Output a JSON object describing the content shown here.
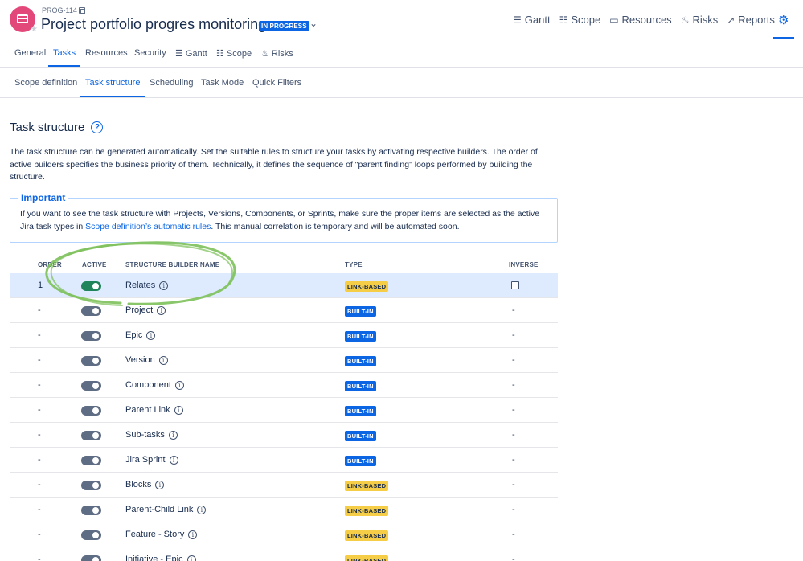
{
  "header": {
    "project_key": "PROG-114",
    "title": "Project portfolio progres monitoring",
    "status": "IN PROGRESS",
    "nav": [
      {
        "label": "Gantt",
        "icon": "gantt-icon",
        "glyph": "☰"
      },
      {
        "label": "Scope",
        "icon": "scope-icon",
        "glyph": "☷"
      },
      {
        "label": "Resources",
        "icon": "resources-icon",
        "glyph": "▭"
      },
      {
        "label": "Risks",
        "icon": "risks-icon",
        "glyph": "🔥"
      },
      {
        "label": "Reports",
        "icon": "reports-icon",
        "glyph": "📈"
      }
    ],
    "settings_icon": "gear-icon"
  },
  "tabs_primary": [
    {
      "label": "General",
      "icon": ""
    },
    {
      "label": "Tasks",
      "icon": "",
      "active": true
    },
    {
      "label": "Resources",
      "icon": ""
    },
    {
      "label": "Security",
      "icon": ""
    },
    {
      "label": "Gantt",
      "icon": "gantt-icon"
    },
    {
      "label": "Scope",
      "icon": "scope-icon"
    },
    {
      "label": "Risks",
      "icon": "risks-icon"
    }
  ],
  "tabs_secondary": [
    {
      "label": "Scope definition"
    },
    {
      "label": "Task structure",
      "active": true
    },
    {
      "label": "Scheduling"
    },
    {
      "label": "Task Mode"
    },
    {
      "label": "Quick Filters"
    }
  ],
  "section": {
    "title": "Task structure",
    "description": "The task structure can be generated automatically. Set the suitable rules to structure your tasks by activating respective builders. The order of active builders specifies the business priority of them. Technically, it defines the sequence of \"parent finding\" loops performed by building the structure."
  },
  "important": {
    "label": "Important",
    "text_before": "If you want to see the task structure with Projects, Versions, Components, or Sprints, make sure the proper items are selected as the active Jira task types in ",
    "link": "Scope definition’s automatic rules",
    "text_after": ". This manual correlation is temporary and will be automated soon."
  },
  "table": {
    "headers": {
      "order": "ORDER",
      "active": "ACTIVE",
      "name": "STRUCTURE BUILDER NAME",
      "type": "TYPE",
      "inverse": "INVERSE"
    },
    "rows": [
      {
        "order": "1",
        "active": true,
        "name": "Relates",
        "type": "LINK-BASED",
        "kind": "link",
        "inverse": "checkbox",
        "selected": true
      },
      {
        "order": "-",
        "active": false,
        "name": "Project",
        "type": "BUILT-IN",
        "kind": "builtin",
        "inverse": "-"
      },
      {
        "order": "-",
        "active": false,
        "name": "Epic",
        "type": "BUILT-IN",
        "kind": "builtin",
        "inverse": "-"
      },
      {
        "order": "-",
        "active": false,
        "name": "Version",
        "type": "BUILT-IN",
        "kind": "builtin",
        "inverse": "-"
      },
      {
        "order": "-",
        "active": false,
        "name": "Component",
        "type": "BUILT-IN",
        "kind": "builtin",
        "inverse": "-"
      },
      {
        "order": "-",
        "active": false,
        "name": "Parent Link",
        "type": "BUILT-IN",
        "kind": "builtin",
        "inverse": "-"
      },
      {
        "order": "-",
        "active": false,
        "name": "Sub-tasks",
        "type": "BUILT-IN",
        "kind": "builtin",
        "inverse": "-"
      },
      {
        "order": "-",
        "active": false,
        "name": "Jira Sprint",
        "type": "BUILT-IN",
        "kind": "builtin",
        "inverse": "-"
      },
      {
        "order": "-",
        "active": false,
        "name": "Blocks",
        "type": "LINK-BASED",
        "kind": "link",
        "inverse": "-"
      },
      {
        "order": "-",
        "active": false,
        "name": "Parent-Child Link",
        "type": "LINK-BASED",
        "kind": "link",
        "inverse": "-"
      },
      {
        "order": "-",
        "active": false,
        "name": "Feature - Story",
        "type": "LINK-BASED",
        "kind": "link",
        "inverse": "-"
      },
      {
        "order": "-",
        "active": false,
        "name": "Initiative - Epic",
        "type": "LINK-BASED",
        "kind": "link",
        "inverse": "-"
      }
    ]
  },
  "colors": {
    "accent": "#0c66e4",
    "toggle_on": "#1f845a",
    "link_badge": "#f5cd47",
    "highlight": "#7dc15a"
  }
}
